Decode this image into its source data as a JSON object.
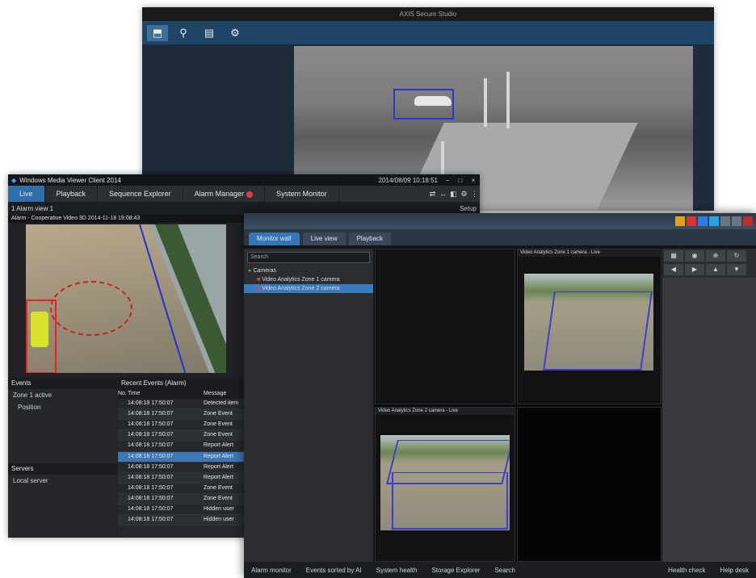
{
  "back_window": {
    "title": "AXIS Secure Studio",
    "toolbar": [
      {
        "icon": "monitor-icon",
        "glyph": "⬒",
        "active": true
      },
      {
        "icon": "search-camera-icon",
        "glyph": "⚲"
      },
      {
        "icon": "document-icon",
        "glyph": "▤"
      },
      {
        "icon": "settings-icon",
        "glyph": "⚙"
      }
    ]
  },
  "left_window": {
    "title": "Windows Media Viewer Client 2014",
    "datetime": "2014/08/09 10:18:51",
    "window_controls": [
      "−",
      "□",
      "×"
    ],
    "tabs": [
      {
        "label": "Live",
        "active": true
      },
      {
        "label": "Playback"
      },
      {
        "label": "Sequence Explorer"
      },
      {
        "label": "Alarm Manager",
        "badge": true
      },
      {
        "label": "System Monitor"
      }
    ],
    "tab_icons": [
      "⇄",
      "↔",
      "◧",
      "⚙",
      "⋮"
    ],
    "view_name": "1 Alarm view 1",
    "setup_label": "Setup",
    "camera_title": "Alarm - Cooperative Video 3D 2014-11-18 19:08:43",
    "events_panel": {
      "heading": "Events",
      "items": [
        "Zone 1 active",
        "Position"
      ]
    },
    "servers_panel": {
      "heading": "Servers",
      "items": [
        "Local server"
      ]
    },
    "table": {
      "heading": "Recent Events (Alarm)",
      "columns": [
        "No.",
        "Time",
        "Message"
      ],
      "rows": [
        {
          "time": "14:08:18 17:50:07",
          "message": "Detected item"
        },
        {
          "time": "14:08:18 17:50:07",
          "message": "Zone Event"
        },
        {
          "time": "14:08:18 17:50:07",
          "message": "Zone Event"
        },
        {
          "time": "14:08:18 17:50:07",
          "message": "Zone Event"
        },
        {
          "time": "14:08:18 17:50:07",
          "message": "Report Alert"
        },
        {
          "time": "14:08:18 17:50:07",
          "message": "Report Alert"
        },
        {
          "time": "14:08:18 17:50:07",
          "message": "Report Alert"
        },
        {
          "time": "14:08:18 17:50:07",
          "message": "Report Alert"
        },
        {
          "time": "14:08:18 17:50:07",
          "message": "Zone Event"
        },
        {
          "time": "14:08:18 17:50:07",
          "message": "Zone Event"
        },
        {
          "time": "14:08:18 17:50:07",
          "message": "Hidden user"
        },
        {
          "time": "14:08:18 17:50:07",
          "message": "Hidden user"
        }
      ],
      "selected_index": 5
    }
  },
  "front_window": {
    "tabs": [
      {
        "label": "Monitor wall",
        "active": true
      },
      {
        "label": "Live view"
      },
      {
        "label": "Playback"
      }
    ],
    "search_placeholder": "Search",
    "tree": [
      {
        "label": "Cameras",
        "level": 0
      },
      {
        "label": "Video Analytics Zone 1 camera",
        "level": 1,
        "selected": false
      },
      {
        "label": "Video Analytics Zone 2 camera",
        "level": 1,
        "selected": true
      }
    ],
    "cell_titles": [
      "Video Analytics Zone 1 camera - Live",
      "Video Analytics Zone 2 camera - Live"
    ],
    "status_bar": [
      "Alarm monitor",
      "Events sorted by AI",
      "System health",
      "Storage Explorer",
      "Search"
    ],
    "status_right": [
      "Health check",
      "Help desk"
    ]
  }
}
